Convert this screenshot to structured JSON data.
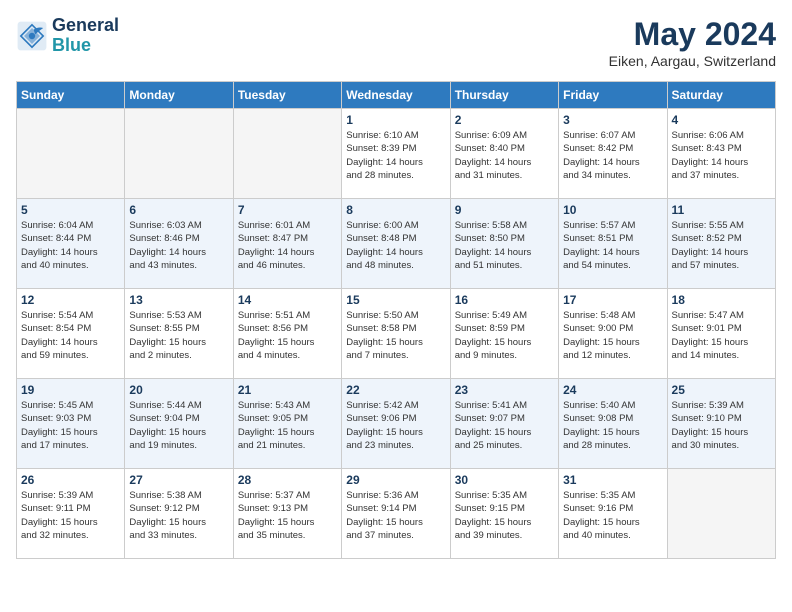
{
  "header": {
    "logo_line1": "General",
    "logo_line2": "Blue",
    "month_title": "May 2024",
    "location": "Eiken, Aargau, Switzerland"
  },
  "days_of_week": [
    "Sunday",
    "Monday",
    "Tuesday",
    "Wednesday",
    "Thursday",
    "Friday",
    "Saturday"
  ],
  "weeks": [
    [
      {
        "day": "",
        "info": ""
      },
      {
        "day": "",
        "info": ""
      },
      {
        "day": "",
        "info": ""
      },
      {
        "day": "1",
        "info": "Sunrise: 6:10 AM\nSunset: 8:39 PM\nDaylight: 14 hours\nand 28 minutes."
      },
      {
        "day": "2",
        "info": "Sunrise: 6:09 AM\nSunset: 8:40 PM\nDaylight: 14 hours\nand 31 minutes."
      },
      {
        "day": "3",
        "info": "Sunrise: 6:07 AM\nSunset: 8:42 PM\nDaylight: 14 hours\nand 34 minutes."
      },
      {
        "day": "4",
        "info": "Sunrise: 6:06 AM\nSunset: 8:43 PM\nDaylight: 14 hours\nand 37 minutes."
      }
    ],
    [
      {
        "day": "5",
        "info": "Sunrise: 6:04 AM\nSunset: 8:44 PM\nDaylight: 14 hours\nand 40 minutes."
      },
      {
        "day": "6",
        "info": "Sunrise: 6:03 AM\nSunset: 8:46 PM\nDaylight: 14 hours\nand 43 minutes."
      },
      {
        "day": "7",
        "info": "Sunrise: 6:01 AM\nSunset: 8:47 PM\nDaylight: 14 hours\nand 46 minutes."
      },
      {
        "day": "8",
        "info": "Sunrise: 6:00 AM\nSunset: 8:48 PM\nDaylight: 14 hours\nand 48 minutes."
      },
      {
        "day": "9",
        "info": "Sunrise: 5:58 AM\nSunset: 8:50 PM\nDaylight: 14 hours\nand 51 minutes."
      },
      {
        "day": "10",
        "info": "Sunrise: 5:57 AM\nSunset: 8:51 PM\nDaylight: 14 hours\nand 54 minutes."
      },
      {
        "day": "11",
        "info": "Sunrise: 5:55 AM\nSunset: 8:52 PM\nDaylight: 14 hours\nand 57 minutes."
      }
    ],
    [
      {
        "day": "12",
        "info": "Sunrise: 5:54 AM\nSunset: 8:54 PM\nDaylight: 14 hours\nand 59 minutes."
      },
      {
        "day": "13",
        "info": "Sunrise: 5:53 AM\nSunset: 8:55 PM\nDaylight: 15 hours\nand 2 minutes."
      },
      {
        "day": "14",
        "info": "Sunrise: 5:51 AM\nSunset: 8:56 PM\nDaylight: 15 hours\nand 4 minutes."
      },
      {
        "day": "15",
        "info": "Sunrise: 5:50 AM\nSunset: 8:58 PM\nDaylight: 15 hours\nand 7 minutes."
      },
      {
        "day": "16",
        "info": "Sunrise: 5:49 AM\nSunset: 8:59 PM\nDaylight: 15 hours\nand 9 minutes."
      },
      {
        "day": "17",
        "info": "Sunrise: 5:48 AM\nSunset: 9:00 PM\nDaylight: 15 hours\nand 12 minutes."
      },
      {
        "day": "18",
        "info": "Sunrise: 5:47 AM\nSunset: 9:01 PM\nDaylight: 15 hours\nand 14 minutes."
      }
    ],
    [
      {
        "day": "19",
        "info": "Sunrise: 5:45 AM\nSunset: 9:03 PM\nDaylight: 15 hours\nand 17 minutes."
      },
      {
        "day": "20",
        "info": "Sunrise: 5:44 AM\nSunset: 9:04 PM\nDaylight: 15 hours\nand 19 minutes."
      },
      {
        "day": "21",
        "info": "Sunrise: 5:43 AM\nSunset: 9:05 PM\nDaylight: 15 hours\nand 21 minutes."
      },
      {
        "day": "22",
        "info": "Sunrise: 5:42 AM\nSunset: 9:06 PM\nDaylight: 15 hours\nand 23 minutes."
      },
      {
        "day": "23",
        "info": "Sunrise: 5:41 AM\nSunset: 9:07 PM\nDaylight: 15 hours\nand 25 minutes."
      },
      {
        "day": "24",
        "info": "Sunrise: 5:40 AM\nSunset: 9:08 PM\nDaylight: 15 hours\nand 28 minutes."
      },
      {
        "day": "25",
        "info": "Sunrise: 5:39 AM\nSunset: 9:10 PM\nDaylight: 15 hours\nand 30 minutes."
      }
    ],
    [
      {
        "day": "26",
        "info": "Sunrise: 5:39 AM\nSunset: 9:11 PM\nDaylight: 15 hours\nand 32 minutes."
      },
      {
        "day": "27",
        "info": "Sunrise: 5:38 AM\nSunset: 9:12 PM\nDaylight: 15 hours\nand 33 minutes."
      },
      {
        "day": "28",
        "info": "Sunrise: 5:37 AM\nSunset: 9:13 PM\nDaylight: 15 hours\nand 35 minutes."
      },
      {
        "day": "29",
        "info": "Sunrise: 5:36 AM\nSunset: 9:14 PM\nDaylight: 15 hours\nand 37 minutes."
      },
      {
        "day": "30",
        "info": "Sunrise: 5:35 AM\nSunset: 9:15 PM\nDaylight: 15 hours\nand 39 minutes."
      },
      {
        "day": "31",
        "info": "Sunrise: 5:35 AM\nSunset: 9:16 PM\nDaylight: 15 hours\nand 40 minutes."
      },
      {
        "day": "",
        "info": ""
      }
    ]
  ]
}
